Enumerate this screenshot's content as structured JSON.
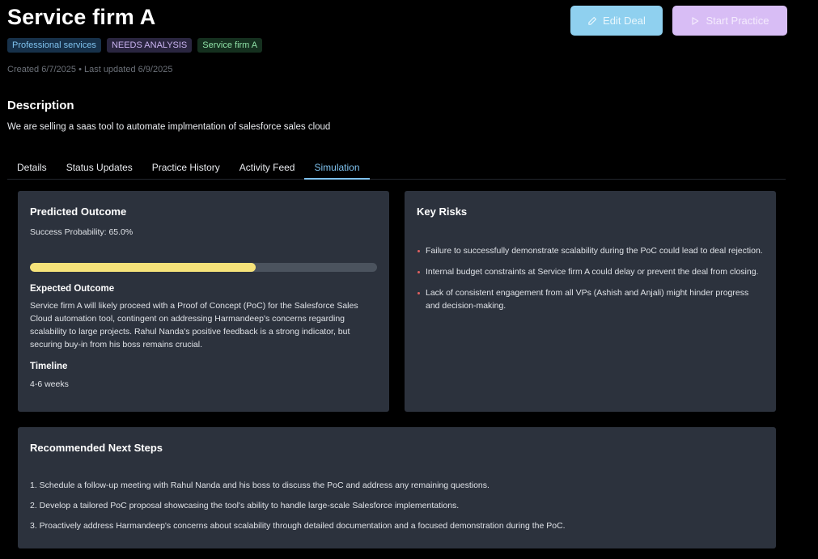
{
  "header": {
    "title": "Service firm A",
    "tags": [
      "Professional services",
      "NEEDS ANALYSIS",
      "Service firm A"
    ],
    "meta": "Created 6/7/2025 • Last updated 6/9/2025",
    "edit_label": "Edit Deal",
    "start_label": "Start Practice"
  },
  "description": {
    "title": "Description",
    "text": "We are selling a saas tool to automate implmentation of salesforce sales cloud"
  },
  "tabs": [
    {
      "label": "Details"
    },
    {
      "label": "Status Updates"
    },
    {
      "label": "Practice History"
    },
    {
      "label": "Activity Feed"
    },
    {
      "label": "Simulation"
    }
  ],
  "active_tab": "Simulation",
  "colors": {
    "accent": "#7fc2ee",
    "progress": "#f6e37a",
    "card_bg": "#2c323d",
    "risk_bullet": "#e06060"
  },
  "outcome": {
    "title": "Predicted Outcome",
    "probability_text": "Success Probability: 65.0%",
    "probability": 65.0,
    "expected_title": "Expected Outcome",
    "expected_text": "Service firm A will likely proceed with a Proof of Concept (PoC) for the Salesforce Sales Cloud automation tool, contingent on addressing Harmandeep's concerns regarding scalability to large projects. Rahul Nanda's positive feedback is a strong indicator, but securing buy-in from his boss remains crucial.",
    "timeline_title": "Timeline",
    "timeline_text": "4-6 weeks"
  },
  "risks": {
    "title": "Key Risks",
    "items": [
      "Failure to successfully demonstrate scalability during the PoC could lead to deal rejection.",
      "Internal budget constraints at Service firm A could delay or prevent the deal from closing.",
      "Lack of consistent engagement from all VPs (Ashish and Anjali) might hinder progress and decision-making."
    ]
  },
  "next_steps": {
    "title": "Recommended Next Steps",
    "items": [
      "1. Schedule a follow-up meeting with Rahul Nanda and his boss to discuss the PoC and address any remaining questions.",
      "2. Develop a tailored PoC proposal showcasing the tool's ability to handle large-scale Salesforce implementations.",
      "3. Proactively address Harmandeep's concerns about scalability through detailed documentation and a focused demonstration during the PoC."
    ]
  }
}
